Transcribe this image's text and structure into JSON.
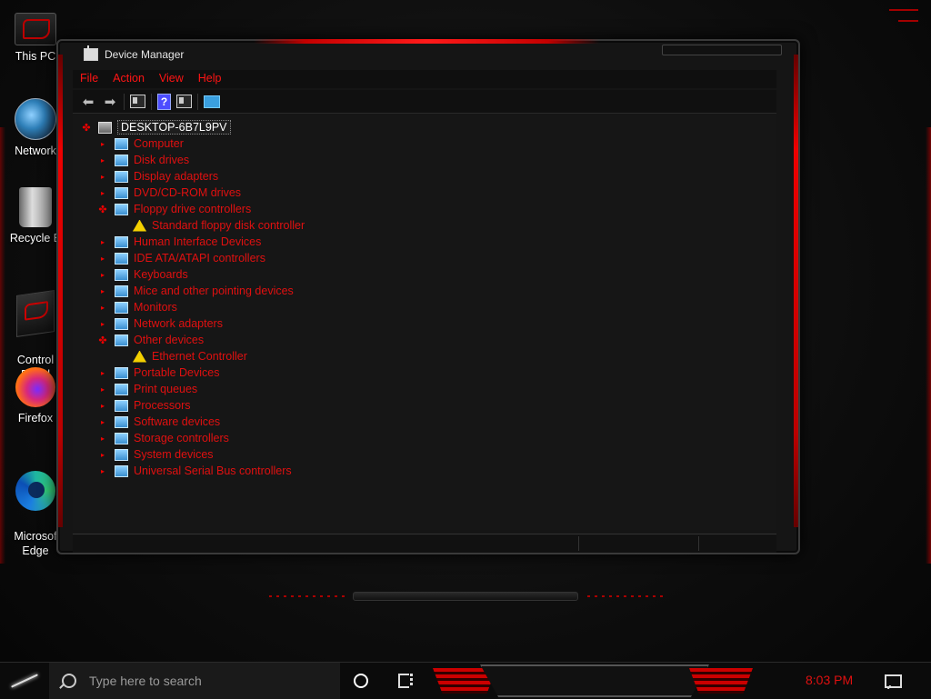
{
  "desktop": {
    "icons": [
      {
        "label": "This PC"
      },
      {
        "label": "Network"
      },
      {
        "label": "Recycle B"
      },
      {
        "label": "Control\nPanel"
      },
      {
        "label": "Firefox"
      },
      {
        "label": "Microsof\nEdge"
      }
    ]
  },
  "window": {
    "title": "Device Manager",
    "menu": [
      "File",
      "Action",
      "View",
      "Help"
    ],
    "toolbar_icons": [
      "back-arrow-icon",
      "forward-arrow-icon",
      "properties-icon",
      "help-icon",
      "update-driver-icon",
      "monitor-scan-icon"
    ]
  },
  "tree": {
    "root": "DESKTOP-6B7L9PV",
    "items": [
      {
        "label": "Computer",
        "expanded": false,
        "icon": "computer-icon"
      },
      {
        "label": "Disk drives",
        "expanded": false,
        "icon": "disk-drive-icon"
      },
      {
        "label": "Display adapters",
        "expanded": false,
        "icon": "display-adapter-icon"
      },
      {
        "label": "DVD/CD-ROM drives",
        "expanded": false,
        "icon": "dvd-drive-icon"
      },
      {
        "label": "Floppy drive controllers",
        "expanded": true,
        "icon": "floppy-controller-icon",
        "children": [
          {
            "label": "Standard floppy disk controller",
            "icon": "warning-device-icon"
          }
        ]
      },
      {
        "label": "Human Interface Devices",
        "expanded": false,
        "icon": "hid-icon"
      },
      {
        "label": "IDE ATA/ATAPI controllers",
        "expanded": false,
        "icon": "ide-controller-icon"
      },
      {
        "label": "Keyboards",
        "expanded": false,
        "icon": "keyboard-icon"
      },
      {
        "label": "Mice and other pointing devices",
        "expanded": false,
        "icon": "mouse-icon"
      },
      {
        "label": "Monitors",
        "expanded": false,
        "icon": "monitor-icon"
      },
      {
        "label": "Network adapters",
        "expanded": false,
        "icon": "network-adapter-icon"
      },
      {
        "label": "Other devices",
        "expanded": true,
        "icon": "other-devices-icon",
        "children": [
          {
            "label": "Ethernet Controller",
            "icon": "warning-device-icon"
          }
        ]
      },
      {
        "label": "Portable Devices",
        "expanded": false,
        "icon": "portable-device-icon"
      },
      {
        "label": "Print queues",
        "expanded": false,
        "icon": "printer-icon"
      },
      {
        "label": "Processors",
        "expanded": false,
        "icon": "processor-icon"
      },
      {
        "label": "Software devices",
        "expanded": false,
        "icon": "software-device-icon"
      },
      {
        "label": "Storage controllers",
        "expanded": false,
        "icon": "storage-controller-icon"
      },
      {
        "label": "System devices",
        "expanded": false,
        "icon": "system-device-icon"
      },
      {
        "label": "Universal Serial Bus controllers",
        "expanded": false,
        "icon": "usb-icon"
      }
    ]
  },
  "taskbar": {
    "search_placeholder": "Type here to search",
    "clock": "8:03 PM"
  },
  "colors": {
    "accent": "#e01010",
    "background": "#151515"
  }
}
